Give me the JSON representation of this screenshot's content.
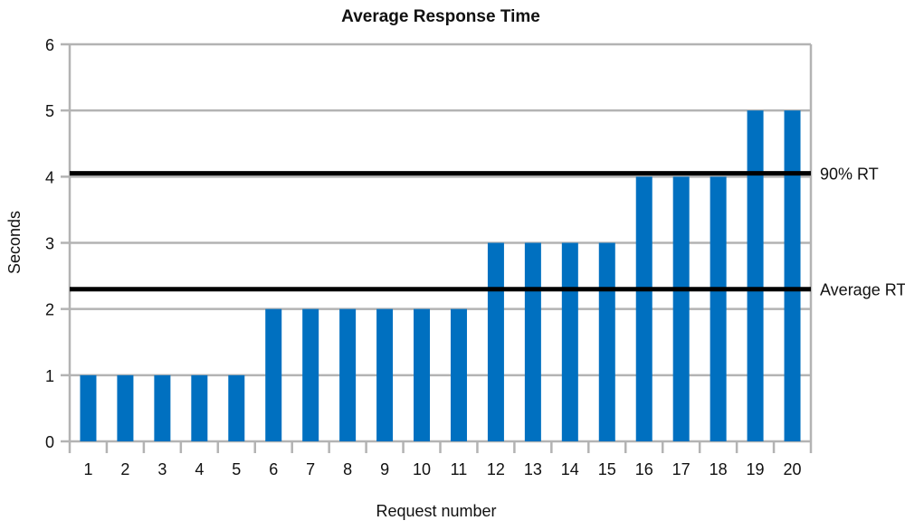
{
  "chart_data": {
    "type": "bar",
    "title": "Average Response Time",
    "xlabel": "Request number",
    "ylabel": "Seconds",
    "ylim": [
      0,
      6
    ],
    "yticks": [
      "0",
      "1",
      "2",
      "3",
      "4",
      "5",
      "6"
    ],
    "categories": [
      "1",
      "2",
      "3",
      "4",
      "5",
      "6",
      "7",
      "8",
      "9",
      "10",
      "11",
      "12",
      "13",
      "14",
      "15",
      "16",
      "17",
      "18",
      "19",
      "20"
    ],
    "values": [
      1,
      1,
      1,
      1,
      1,
      2,
      2,
      2,
      2,
      2,
      2,
      3,
      3,
      3,
      3,
      4,
      4,
      4,
      5,
      5
    ],
    "grid": "horizontal",
    "bar_color": "#0070c0",
    "reference_lines": [
      {
        "label": "90% RT",
        "value": 4.05,
        "color": "#000000"
      },
      {
        "label": "Average RT",
        "value": 2.3,
        "color": "#000000"
      }
    ]
  }
}
